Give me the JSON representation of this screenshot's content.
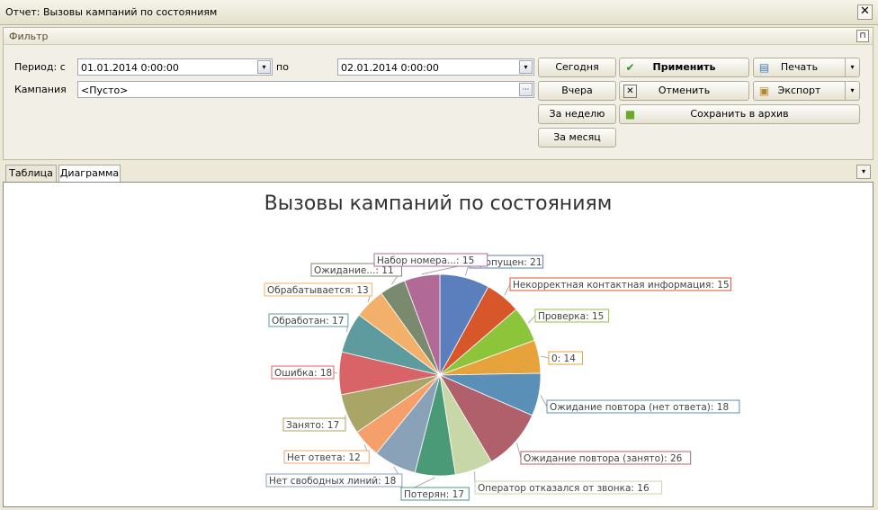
{
  "window": {
    "title": "Отчет: Вызовы кампаний по состояниям",
    "close_glyph": "✕"
  },
  "filter": {
    "header": "Фильтр",
    "pin_glyph": "⊓",
    "period_label": "Период: с",
    "date_from": "01.01.2014 0:00:00",
    "to_label": "по",
    "date_to": "02.01.2014 0:00:00",
    "campaign_label": "Кампания",
    "campaign_value": "<Пусто>",
    "ellipsis": "···",
    "drop_glyph": "▾"
  },
  "buttons": {
    "today": "Сегодня",
    "yesterday": "Вчера",
    "week": "За неделю",
    "month": "За месяц",
    "apply": "Применить",
    "cancel": "Отменить",
    "save_archive": "Сохранить в архив",
    "print": "Печать",
    "export": "Экспорт"
  },
  "icons": {
    "apply": "check-icon",
    "cancel": "cancel-icon",
    "save_archive": "archive-icon",
    "print": "printer-icon",
    "export": "briefcase-icon"
  },
  "tabs": [
    {
      "label": "Таблица",
      "active": false
    },
    {
      "label": "Диаграмма",
      "active": true
    }
  ],
  "chart_data": {
    "type": "pie",
    "title": "Вызовы кампаний по состояниям",
    "slices": [
      {
        "label": "Пропущен",
        "value": 21,
        "color": "#5b7fbd"
      },
      {
        "label": "Некорректная контактная информация",
        "value": 15,
        "color": "#d8572a"
      },
      {
        "label": "Проверка",
        "value": 15,
        "color": "#8cc43a"
      },
      {
        "label": "0",
        "value": 14,
        "color": "#e6a33b"
      },
      {
        "label": "Ожидание повтора (нет ответа)",
        "value": 18,
        "color": "#5a8fb8"
      },
      {
        "label": "Ожидание повтора (занято)",
        "value": 26,
        "color": "#b0606b"
      },
      {
        "label": "Оператор отказался от звонка",
        "value": 16,
        "color": "#c7d7a8"
      },
      {
        "label": "Потерян",
        "value": 17,
        "color": "#4a9a78"
      },
      {
        "label": "Нет свободных линий",
        "value": 18,
        "color": "#8aa2b8"
      },
      {
        "label": "Нет ответа",
        "value": 12,
        "color": "#f5a06a"
      },
      {
        "label": "Занято",
        "value": 17,
        "color": "#a8a567"
      },
      {
        "label": "Ошибка",
        "value": 18,
        "color": "#d86468"
      },
      {
        "label": "Обработан",
        "value": 17,
        "color": "#5e9b9e"
      },
      {
        "label": "Обрабатывается",
        "value": 13,
        "color": "#f3b06a"
      },
      {
        "label": "Ожидание...",
        "value": 11,
        "color": "#7a8a6e"
      },
      {
        "label": "Набор номера...",
        "value": 15,
        "color": "#b06a95"
      }
    ]
  }
}
